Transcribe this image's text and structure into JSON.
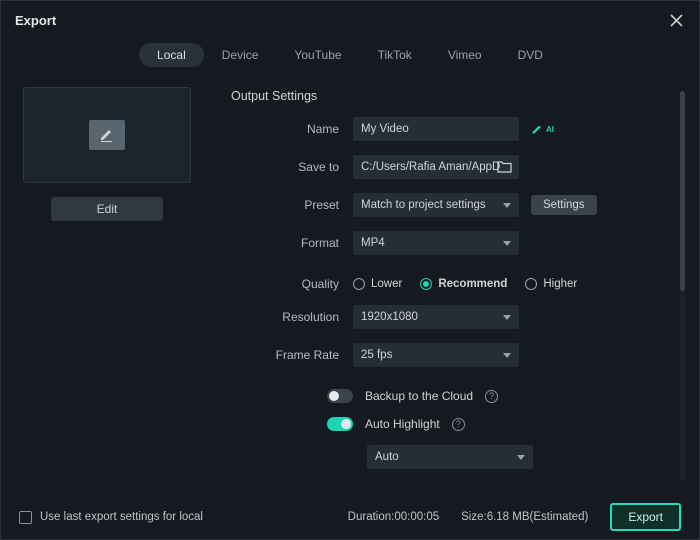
{
  "title": "Export",
  "tabs": [
    "Local",
    "Device",
    "YouTube",
    "TikTok",
    "Vimeo",
    "DVD"
  ],
  "active_tab": 0,
  "edit_button": "Edit",
  "section": "Output Settings",
  "fields": {
    "name_label": "Name",
    "name_value": "My Video",
    "saveto_label": "Save to",
    "saveto_value": "C:/Users/Rafia Aman/AppData",
    "preset_label": "Preset",
    "preset_value": "Match to project settings",
    "settings_btn": "Settings",
    "format_label": "Format",
    "format_value": "MP4",
    "quality_label": "Quality",
    "quality_options": [
      "Lower",
      "Recommend",
      "Higher"
    ],
    "quality_selected": 1,
    "resolution_label": "Resolution",
    "resolution_value": "1920x1080",
    "framerate_label": "Frame Rate",
    "framerate_value": "25 fps",
    "backup_label": "Backup to the Cloud",
    "autohl_label": "Auto Highlight",
    "autohl_value": "Auto"
  },
  "footer": {
    "checkbox_label": "Use last export settings for local",
    "duration_label": "Duration:",
    "duration_value": "00:00:05",
    "size_label": "Size:",
    "size_value": "6.18 MB(Estimated)",
    "export_btn": "Export"
  }
}
